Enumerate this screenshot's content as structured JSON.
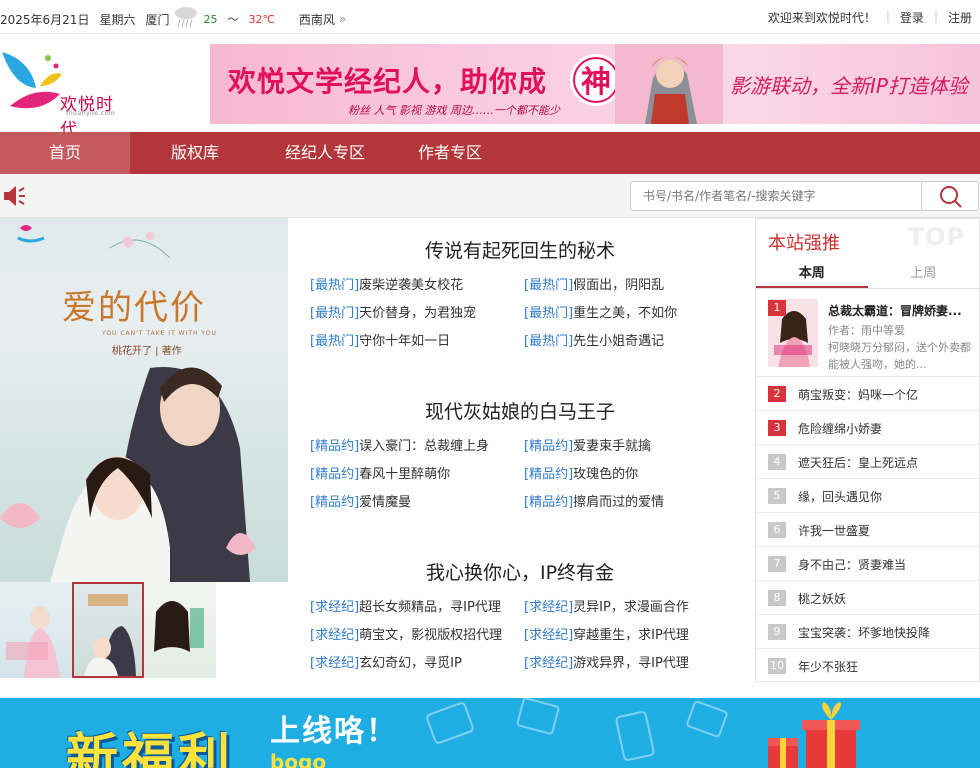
{
  "topbar": {
    "date": "2025年6月21日",
    "weekday": "星期六",
    "city": "厦门",
    "temp_low": "25",
    "temp_sep": "～",
    "temp_high": "32℃",
    "wind": "西南风",
    "welcome": "欢迎来到欢悦时代！",
    "login": "登录",
    "register": "注册"
  },
  "logo": {
    "name": "欢悦时代",
    "domain": "thuanyue.com"
  },
  "banner": {
    "title": "欢悦文学经纪人，助你成",
    "title_char": "神",
    "subtitle": "粉丝  人气  影视  游戏  周边……一个都不能少",
    "right": "影游联动，全新IP打造体验"
  },
  "nav": {
    "items": [
      "首页",
      "版权库",
      "经纪人专区",
      "作者专区"
    ]
  },
  "search": {
    "placeholder": "书号/书名/作者笔名/-搜索关键字"
  },
  "cover": {
    "title": "爱的代价",
    "en": "YOU CAN'T TAKE IT WITH YOU",
    "author": "桃花开了 | 著作"
  },
  "sections": [
    {
      "title": "传说有起死回生的秘术",
      "links": [
        {
          "tag": "[最热门]",
          "text": "废柴逆袭美女校花"
        },
        {
          "tag": "[最热门]",
          "text": "假面出，阴阳乱"
        },
        {
          "tag": "[最热门]",
          "text": "天价替身，为君独宠"
        },
        {
          "tag": "[最热门]",
          "text": "重生之美，不如你"
        },
        {
          "tag": "[最热门]",
          "text": "守你十年如一日"
        },
        {
          "tag": "[最热门]",
          "text": "先生小姐奇遇记"
        }
      ]
    },
    {
      "title": "现代灰姑娘的白马王子",
      "links": [
        {
          "tag": "[精品约]",
          "text": "误入豪门：总裁缠上身"
        },
        {
          "tag": "[精品约]",
          "text": "爱妻束手就擒"
        },
        {
          "tag": "[精品约]",
          "text": "春风十里醉萌你"
        },
        {
          "tag": "[精品约]",
          "text": "玫瑰色的你"
        },
        {
          "tag": "[精品约]",
          "text": "爱情魔曼"
        },
        {
          "tag": "[精品约]",
          "text": "擦肩而过的爱情"
        }
      ]
    },
    {
      "title": "我心换你心，IP终有金",
      "links": [
        {
          "tag": "[求经纪]",
          "text": "超长女频精品，寻IP代理"
        },
        {
          "tag": "[求经纪]",
          "text": "灵异IP，求漫画合作"
        },
        {
          "tag": "[求经纪]",
          "text": "萌宝文，影视版权招代理"
        },
        {
          "tag": "[求经纪]",
          "text": "穿越重生，求IP代理"
        },
        {
          "tag": "[求经纪]",
          "text": "玄幻奇幻，寻觅IP"
        },
        {
          "tag": "[求经纪]",
          "text": "游戏异界，寻IP代理"
        }
      ]
    }
  ],
  "rank": {
    "title": "本站强推",
    "watermark": "TOP",
    "tabs": [
      "本周",
      "上周"
    ],
    "first": {
      "num": "1",
      "title": "总裁太霸道：冒牌娇妻...",
      "author": "作者：雨中等爱",
      "desc": "柯晓晓万分郁闷，送个外卖都能被人强吻，她的..."
    },
    "items": [
      {
        "num": "2",
        "title": "萌宝叛变：妈咪一个亿"
      },
      {
        "num": "3",
        "title": "危险缠绵小娇妻"
      },
      {
        "num": "4",
        "title": "遮天狂后：皇上死远点"
      },
      {
        "num": "5",
        "title": "缘，回头遇见你"
      },
      {
        "num": "6",
        "title": "许我一世盛夏"
      },
      {
        "num": "7",
        "title": "身不由己：贤妻难当"
      },
      {
        "num": "8",
        "title": "桃之妖妖"
      },
      {
        "num": "9",
        "title": "宝宝突袭：坏爹地快投降"
      },
      {
        "num": "10",
        "title": "年少不张狂"
      }
    ]
  },
  "bottom_banner": {
    "title": "新福利",
    "subtitle": "上线咯！",
    "hint": "bogo"
  },
  "colors": {
    "nav": "#b3363b",
    "tag": "#2f7ccc",
    "rank_hot": "#d9333b",
    "bottom_banner": "#1faee4"
  }
}
